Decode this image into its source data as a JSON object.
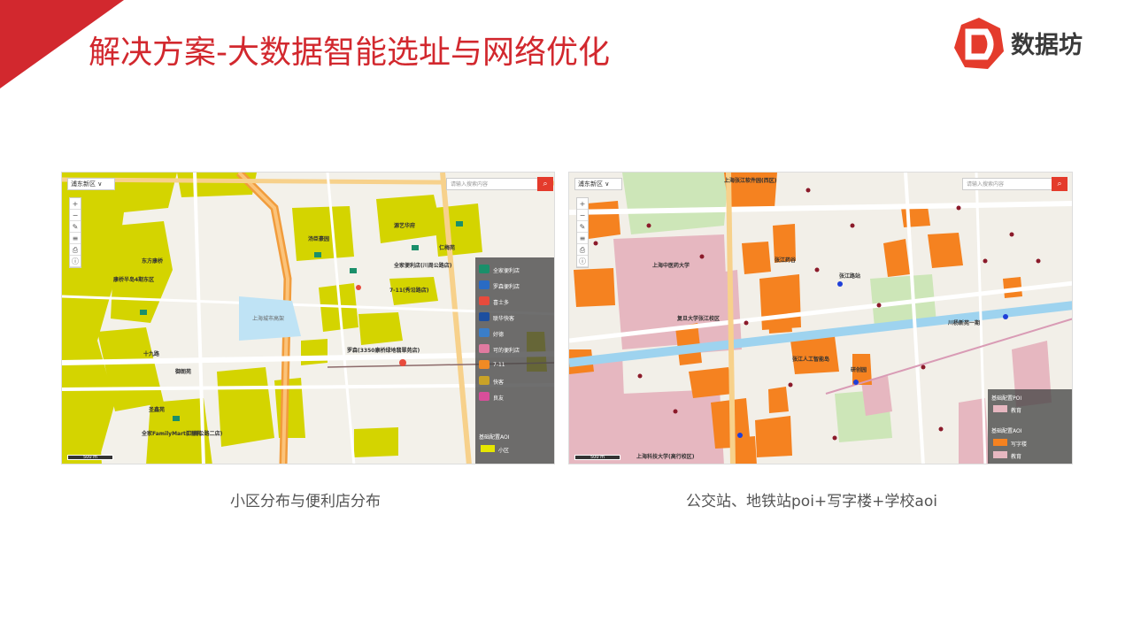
{
  "slide": {
    "title": "解决方案-大数据智能选址与网络优化",
    "logo_text": "数据坊",
    "accent_color": "#d2282e"
  },
  "map1": {
    "district": "浦东新区 ∨",
    "search_placeholder": "请输入搜索内容",
    "scale": "500 m",
    "caption": "小区分布与便利店分布",
    "legend_items": [
      "全家便利店",
      "罗森便利店",
      "喜士多",
      "联华快客",
      "好德",
      "可的便利店",
      "7-11",
      "快客",
      "良友",
      "小区"
    ],
    "legend_title": "基础配置AOI",
    "labels": [
      "汤臣豪园",
      "源艺华府",
      "东方康桥",
      "全家便利店(川周公路店)",
      "7-11(秀沿路店)",
      "罗森(3350康桥绿地翡翠苑店)",
      "十九路",
      "康桥半岛4期东区",
      "圣鑫苑",
      "仁梅苑",
      "御朗苑",
      "汇丽苑",
      "全家FamilyMart(川周公路二店)",
      "上海城市高架"
    ]
  },
  "map2": {
    "district": "浦东新区 ∨",
    "search_placeholder": "请输入搜索内容",
    "scale": "500 m",
    "caption": "公交站、地铁站poi+写字楼+学校aoi",
    "legend_title_poi": "基础配置POI",
    "legend_title_aoi": "基础配置AOI",
    "legend_items": [
      "教育",
      "写字楼",
      "教育"
    ],
    "labels": [
      "上海张江软件园(西区)",
      "张江药谷",
      "复旦大学张江校区",
      "张江人工智能岛",
      "研创园",
      "上海中医药大学",
      "上海科技大学(高行校区)",
      "张江路站",
      "川杨新苑一期"
    ]
  }
}
